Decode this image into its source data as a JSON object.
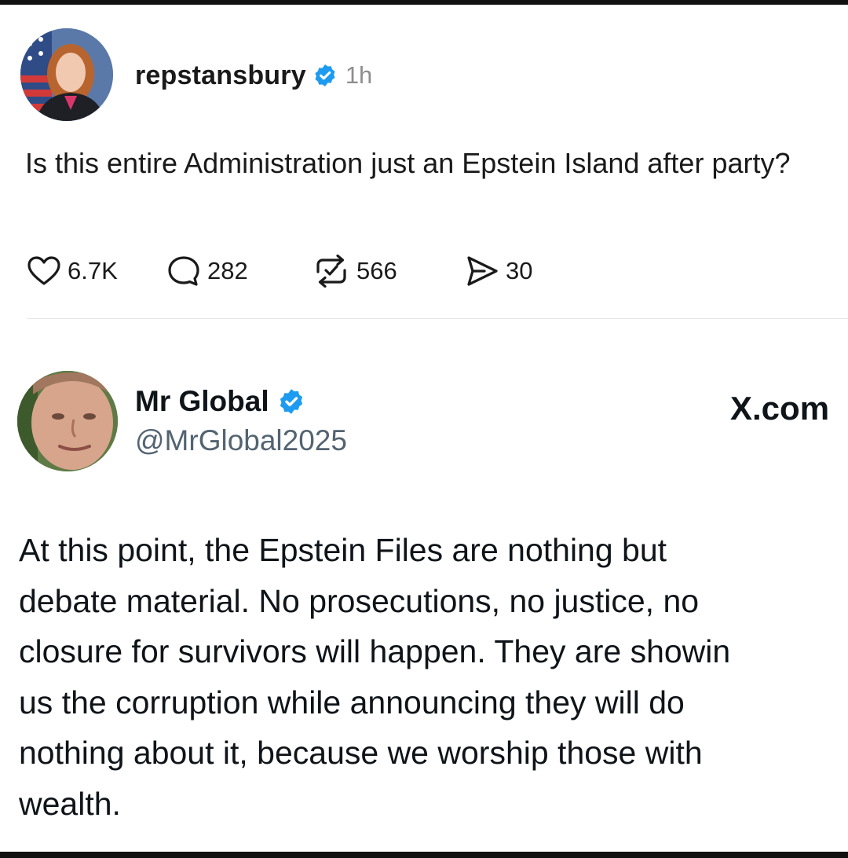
{
  "post1": {
    "username": "repstansbury",
    "time": "1h",
    "text": "Is this entire Administration just an Epstein Island after party?",
    "actions": {
      "likes": "6.7K",
      "replies": "282",
      "reposts": "566",
      "shares": "30"
    }
  },
  "post2": {
    "display_name": "Mr Global",
    "handle": "@MrGlobal2025",
    "source": "X.com",
    "text_lines": [
      "At this point, the Epstein Files are nothing but",
      "debate material. No prosecutions, no justice, no",
      "closure for survivors will happen. They are showin",
      "us the corruption while announcing they will do",
      "nothing about it, because we worship those with",
      "wealth."
    ]
  },
  "colors": {
    "verified": "#1d9bf0",
    "muted": "#8e8e8e",
    "handle": "#536471"
  }
}
